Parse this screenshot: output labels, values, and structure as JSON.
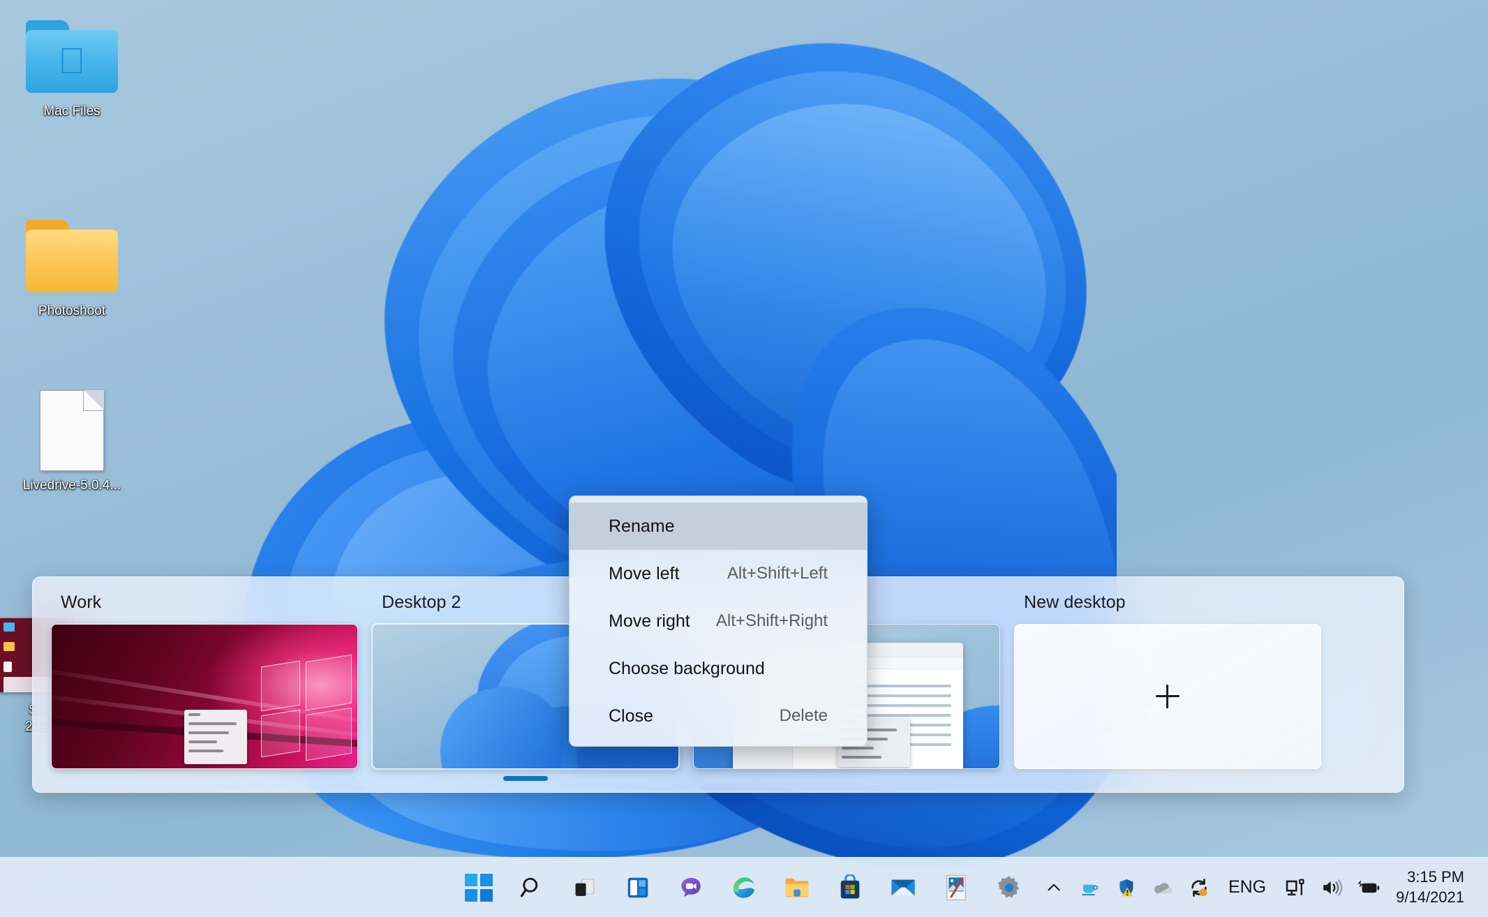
{
  "desktop": {
    "wallpaper_name": "windows-11-bloom",
    "background_color": "#91b8d4",
    "icons": [
      {
        "name": "mac-files-folder",
        "label": "Mac Files",
        "type": "folder-apple",
        "color": "#3fb0e8"
      },
      {
        "name": "photoshoot-folder",
        "label": "Photoshoot",
        "type": "folder",
        "color": "#f8c550"
      },
      {
        "name": "livedrive-installer",
        "label": "Livedrive-5.0.4...",
        "type": "document"
      },
      {
        "name": "screenshot-file",
        "label_line1": "Sc",
        "label_line2": "202",
        "type": "screenshot"
      }
    ]
  },
  "task_view": {
    "name": "virtual-desktops-switcher",
    "desktops": [
      {
        "name": "desktop-work",
        "label": "Work",
        "thumbnail": "windows-10-hero-pink",
        "active": false
      },
      {
        "name": "desktop-2",
        "label": "Desktop 2",
        "thumbnail": "windows-11-bloom",
        "active": true
      },
      {
        "name": "desktop-3",
        "label": "",
        "thumbnail": "file-explorer-window",
        "active": false
      }
    ],
    "new_desktop": {
      "label": "New desktop",
      "icon": "plus-icon"
    },
    "active_indicator_color": "#1176bc"
  },
  "context_menu": {
    "name": "desktop-context-menu",
    "items": [
      {
        "label": "Rename",
        "accel": "",
        "highlighted": true
      },
      {
        "label": "Move left",
        "accel": "Alt+Shift+Left",
        "highlighted": false
      },
      {
        "label": "Move right",
        "accel": "Alt+Shift+Right",
        "highlighted": false
      },
      {
        "label": "Choose background",
        "accel": "",
        "highlighted": false
      },
      {
        "label": "Close",
        "accel": "Delete",
        "highlighted": false
      }
    ]
  },
  "taskbar": {
    "buttons": [
      {
        "name": "start-button",
        "icon": "windows-logo-icon",
        "label": "Start"
      },
      {
        "name": "search-button",
        "icon": "search-icon",
        "label": "Search"
      },
      {
        "name": "task-view-button",
        "icon": "task-view-icon",
        "label": "Task View"
      },
      {
        "name": "widgets-button",
        "icon": "widgets-icon",
        "label": "Widgets"
      },
      {
        "name": "chat-button",
        "icon": "teams-chat-icon",
        "label": "Chat"
      },
      {
        "name": "edge-button",
        "icon": "edge-icon",
        "label": "Microsoft Edge"
      },
      {
        "name": "file-explorer-button",
        "icon": "folder-icon",
        "label": "File Explorer"
      },
      {
        "name": "store-button",
        "icon": "microsoft-store-icon",
        "label": "Microsoft Store"
      },
      {
        "name": "mail-button",
        "icon": "mail-icon",
        "label": "Mail"
      },
      {
        "name": "paint-button",
        "icon": "paint-icon",
        "label": "Paint"
      },
      {
        "name": "settings-button",
        "icon": "gear-icon",
        "label": "Settings"
      }
    ],
    "tray": [
      {
        "name": "show-hidden-icons",
        "icon": "chevron-up-icon"
      },
      {
        "name": "coffee-tray-icon",
        "icon": "coffee-cup-icon"
      },
      {
        "name": "security-tray-icon",
        "icon": "shield-warning-icon"
      },
      {
        "name": "onedrive-tray-icon",
        "icon": "cloud-icon"
      },
      {
        "name": "sync-tray-icon",
        "icon": "sync-arrows-icon"
      }
    ],
    "language": "ENG",
    "status": [
      {
        "name": "network-icon",
        "icon": "monitor-network-icon"
      },
      {
        "name": "volume-icon",
        "icon": "speaker-icon"
      },
      {
        "name": "battery-icon",
        "icon": "battery-charging-icon"
      }
    ],
    "clock": {
      "time": "3:15 PM",
      "date": "9/14/2021"
    }
  }
}
